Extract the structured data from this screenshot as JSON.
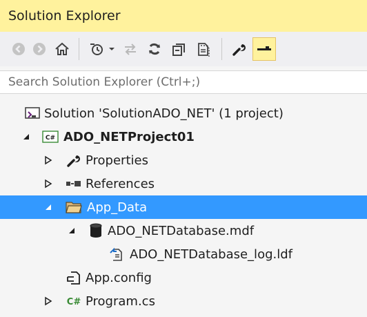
{
  "panel": {
    "title": "Solution Explorer"
  },
  "toolbar": {
    "buttons": [
      {
        "name": "back-button",
        "icon": "back-arrow-icon"
      },
      {
        "name": "forward-button",
        "icon": "forward-arrow-icon"
      },
      {
        "name": "home-button",
        "icon": "home-icon"
      },
      {
        "name": "pending-changes-filter-button",
        "icon": "history-clock-icon"
      },
      {
        "name": "sync-button",
        "icon": "sync-arrows-icon"
      },
      {
        "name": "refresh-button",
        "icon": "refresh-icon"
      },
      {
        "name": "collapse-all-button",
        "icon": "collapse-all-icon"
      },
      {
        "name": "show-all-files-button",
        "icon": "show-all-files-icon"
      },
      {
        "name": "properties-button",
        "icon": "wrench-icon"
      },
      {
        "name": "preview-selected-button",
        "icon": "preview-icon",
        "active": true
      }
    ],
    "active_color": "#fff29d"
  },
  "search": {
    "placeholder": "Search Solution Explorer (Ctrl+;)"
  },
  "tree": {
    "selected_color": "#3399ff",
    "items": [
      {
        "label": "Solution 'SolutionADO_NET' (1 project)",
        "icon": "solution-icon",
        "expander": "none"
      },
      {
        "label": "ADO_NETProject01",
        "icon": "csharp-project-icon",
        "expander": "expanded"
      },
      {
        "label": "Properties",
        "icon": "wrench-icon",
        "expander": "collapsed"
      },
      {
        "label": "References",
        "icon": "references-icon",
        "expander": "collapsed"
      },
      {
        "label": "App_Data",
        "icon": "folder-icon",
        "expander": "expanded",
        "selected": true
      },
      {
        "label": "ADO_NETDatabase.mdf",
        "icon": "database-icon",
        "expander": "expanded"
      },
      {
        "label": "ADO_NETDatabase_log.ldf",
        "icon": "log-file-icon",
        "expander": "none"
      },
      {
        "label": "App.config",
        "icon": "config-file-icon",
        "expander": "none"
      },
      {
        "label": "Program.cs",
        "icon": "csharp-file-icon",
        "expander": "collapsed"
      }
    ]
  }
}
